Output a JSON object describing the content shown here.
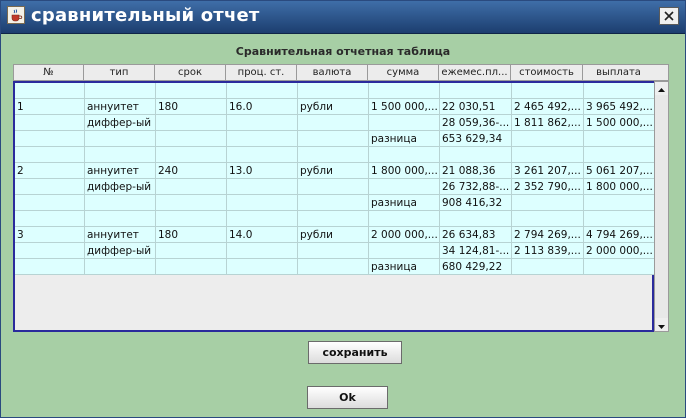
{
  "window": {
    "title": "сравнительный отчет"
  },
  "table": {
    "caption": "Сравнительная отчетная таблица",
    "headers": [
      "№",
      "тип",
      "срок",
      "проц. ст.",
      "валюта",
      "сумма",
      "ежемес.пл...",
      "стоимость",
      "выплата"
    ],
    "rows": [
      [
        "",
        "",
        "",
        "",
        "",
        "",
        "",
        "",
        ""
      ],
      [
        "1",
        "аннуитет",
        "180",
        "16.0",
        "рубли",
        "1 500 000,...",
        "22 030,51",
        "2 465 492,...",
        "3 965 492,..."
      ],
      [
        "",
        "диффер-ый",
        "",
        "",
        "",
        "",
        "28 059,36-...",
        "1 811 862,...",
        "1 500 000,..."
      ],
      [
        "",
        "",
        "",
        "",
        "",
        "разница",
        "653 629,34",
        "",
        ""
      ],
      [
        "",
        "",
        "",
        "",
        "",
        "",
        "",
        "",
        ""
      ],
      [
        "2",
        "аннуитет",
        "240",
        "13.0",
        "рубли",
        "1 800 000,...",
        "21 088,36",
        "3 261 207,...",
        "5 061 207,..."
      ],
      [
        "",
        "диффер-ый",
        "",
        "",
        "",
        "",
        "26 732,88-...",
        "2 352 790,...",
        "1 800 000,..."
      ],
      [
        "",
        "",
        "",
        "",
        "",
        "разница",
        "908 416,32",
        "",
        ""
      ],
      [
        "",
        "",
        "",
        "",
        "",
        "",
        "",
        "",
        ""
      ],
      [
        "3",
        "аннуитет",
        "180",
        "14.0",
        "рубли",
        "2 000 000,...",
        "26 634,83",
        "2 794 269,...",
        "4 794 269,..."
      ],
      [
        "",
        "диффер-ый",
        "",
        "",
        "",
        "",
        "34 124,81-...",
        "2 113 839,...",
        "2 000 000,..."
      ],
      [
        "",
        "",
        "",
        "",
        "",
        "разница",
        "680 429,22",
        "",
        ""
      ]
    ]
  },
  "buttons": {
    "save": "сохранить",
    "ok": "Ok"
  },
  "icons": {
    "app": "java-cup-icon",
    "close": "close-icon",
    "scroll_up": "arrow-up-icon",
    "scroll_down": "arrow-down-icon"
  }
}
